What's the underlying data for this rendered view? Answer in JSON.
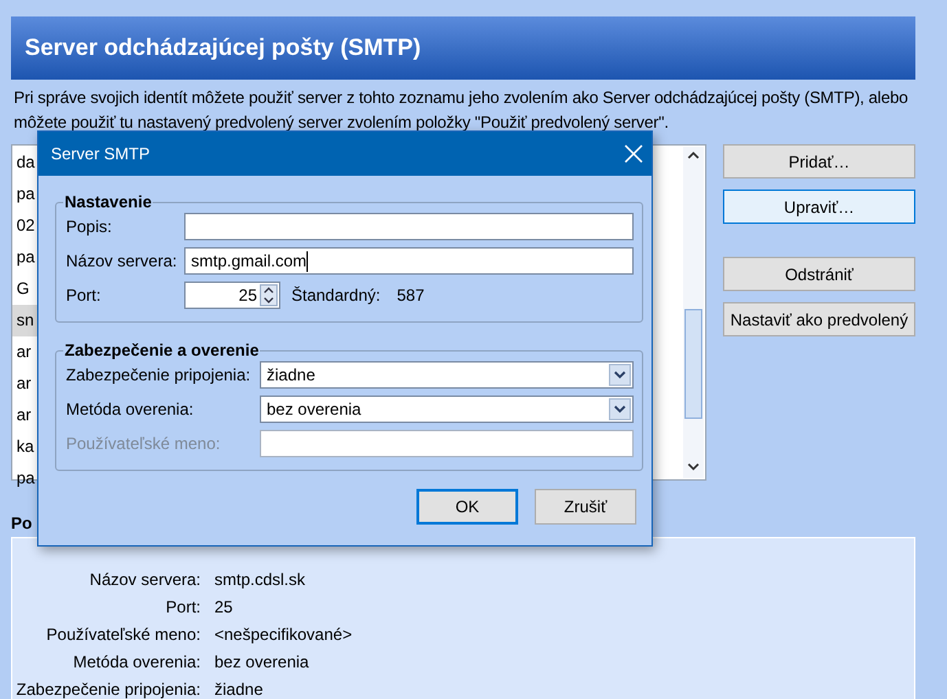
{
  "page_title": "Server odchádzajúcej pošty (SMTP)",
  "description": "Pri správe svojich identít môžete použiť server z tohto zoznamu jeho zvolením ako Server odchádzajúcej pošty (SMTP), alebo môžete použiť tu nastavený predvolený server zvolením položky \"Použiť predvolený server\".",
  "servers": [
    {
      "label": "da",
      "selected": false
    },
    {
      "label": "pa",
      "selected": false
    },
    {
      "label": "02",
      "selected": false
    },
    {
      "label": "pa",
      "selected": false
    },
    {
      "label": "G",
      "selected": false
    },
    {
      "label": "sn",
      "selected": true
    },
    {
      "label": "ar",
      "selected": false
    },
    {
      "label": "ar",
      "selected": false
    },
    {
      "label": "ar",
      "selected": false
    },
    {
      "label": "ka",
      "selected": false
    },
    {
      "label": "pa",
      "selected": false
    }
  ],
  "button_groups": [
    [
      {
        "label": "Pridať…",
        "focused": false
      },
      {
        "label": "Upraviť…",
        "focused": true
      }
    ],
    [
      {
        "label": "Odstrániť",
        "focused": false
      },
      {
        "label": "Nastaviť ako predvolený",
        "focused": false
      }
    ]
  ],
  "details": {
    "heading": "Po",
    "rows": [
      {
        "label": "Názov servera:",
        "value": "smtp.cdsl.sk"
      },
      {
        "label": "Port:",
        "value": "25"
      },
      {
        "label": "Používateľské meno:",
        "value": "<nešpecifikované>"
      },
      {
        "label": "Metóda overenia:",
        "value": "bez overenia"
      },
      {
        "label": "Zabezpečenie pripojenia:",
        "value": "žiadne"
      }
    ]
  },
  "dialog": {
    "title": "Server SMTP",
    "groups": [
      {
        "title": "Nastavenie",
        "fields": [
          {
            "kind": "text",
            "label": "Popis:",
            "disabled": false
          },
          {
            "kind": "text",
            "label": "Názov servera:",
            "value": "smtp.gmail.com",
            "disabled": false,
            "focused": true
          },
          {
            "kind": "spin",
            "label": "Port:",
            "value": "25",
            "hint_label": "Štandardný:",
            "hint_value": "587",
            "disabled": false
          }
        ]
      },
      {
        "title": "Zabezpečenie a overenie",
        "fields": [
          {
            "kind": "select",
            "label": "Zabezpečenie pripojenia:",
            "value": "žiadne",
            "disabled": false
          },
          {
            "kind": "select",
            "label": "Metóda overenia:",
            "value": "bez overenia",
            "disabled": false
          },
          {
            "kind": "text",
            "label": "Používateľské meno:",
            "disabled": true
          }
        ]
      }
    ],
    "buttons": [
      {
        "label": "OK",
        "focused": true
      },
      {
        "label": "Zrušiť",
        "focused": false
      }
    ]
  }
}
